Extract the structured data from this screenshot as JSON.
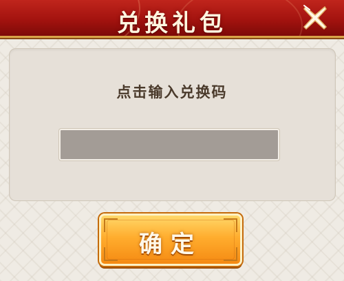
{
  "dialog": {
    "title": "兑换礼包",
    "close_icon": "close-icon",
    "prompt": "点击输入兑换码",
    "code_input": {
      "value": "",
      "placeholder": ""
    },
    "confirm_label": "确定"
  },
  "colors": {
    "title_bar": "#a3130f",
    "panel": "#e6e0d8",
    "input": "#a39c96",
    "confirm_button": "#ffad2e",
    "prompt_text": "#4a3a2b"
  }
}
